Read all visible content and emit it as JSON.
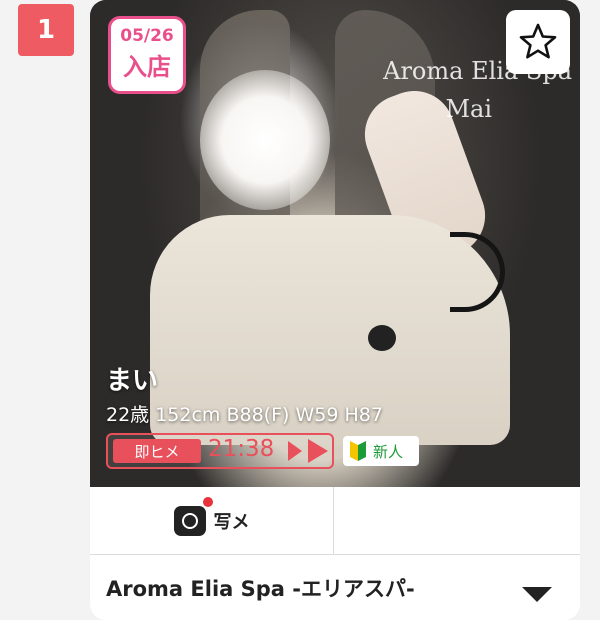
{
  "listing": {
    "rank": "1",
    "card": {
      "arrival_badge": {
        "date": "05/26",
        "text": "入店"
      },
      "watermark": {
        "shop": "Aroma Elia Spa",
        "name": "Mai"
      },
      "favorite_icon": "star-outline-icon",
      "name": "まい",
      "stats": "22歳 152cm B88(F) W59 H87",
      "schedule": {
        "label": "即ヒメ",
        "time": "21:38",
        "arrow_icon": "play-arrow-icon"
      },
      "new_tag": {
        "text": "新人",
        "icon": "beginner-mark-icon"
      },
      "actions": {
        "photo_diary_label": "写メ",
        "photo_diary_icon": "instagram-camera-icon"
      },
      "shop_name": "Aroma Elia Spa -エリアスパ-",
      "expand_icon": "chevron-down-icon"
    }
  },
  "colors": {
    "rank_badge": "#ee5b62",
    "arrival_pink": "#e94f8a",
    "schedule_red": "#e8505b",
    "new_green": "#1c9b38",
    "notification_dot": "#e8323c"
  }
}
